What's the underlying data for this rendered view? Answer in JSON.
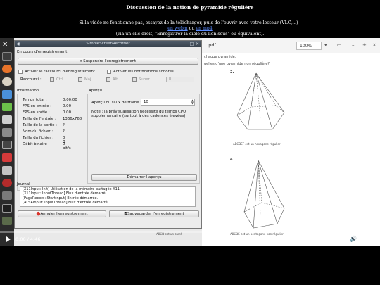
{
  "page": {
    "title": "Discussion de la notion de pyramide régulière",
    "info_line1": "Si la vidéo ne fonctionne pas, essayez de la télécharger, puis de l'ouvrir avec votre lecteur (VLC,...) :",
    "link_webm": "en webm",
    "link_sep": " ou ",
    "link_mp4": "en mp4",
    "info_line3": "(via un clic droit, \"Enregistrer la cible du lien sous\" ou équivalent)."
  },
  "pdf": {
    "filename": "...pdf",
    "zoom": "100%",
    "line1": "chaque pyramide.",
    "line2": "uelles d'une pyramide non régulière?",
    "fig2_num": "2.",
    "fig2_caption": "ABCDEF est un hexagone régulier",
    "fig4_num": "4.",
    "bottom_left": "ABCD est un carré",
    "bottom_right": "ABCDE est un pentagone non régulier"
  },
  "recorder": {
    "window_title": "SimpleScreenRecorder",
    "section_recording": "En cours d'enregistrement",
    "pause_button": "Suspendre l'enregistrement",
    "hotkey_label": "Activer le raccourci d'enregistrement",
    "sound_label": "Activer les notifications sonores",
    "shortcut_label": "Raccourci :",
    "mod_ctrl": "Ctrl",
    "mod_shift": "Maj",
    "mod_alt": "Alt",
    "mod_super": "Super",
    "key_value": "R",
    "info_title": "Information",
    "info_rows": [
      {
        "label": "Temps total :",
        "value": "0:00:00"
      },
      {
        "label": "FPS en entrée :",
        "value": "0.00"
      },
      {
        "label": "FPS en sortie :",
        "value": "0.00"
      },
      {
        "label": "Taille de l'entrée :",
        "value": "1366x768"
      },
      {
        "label": "Taille de la sortie :",
        "value": "?"
      },
      {
        "label": "Nom du fichier :",
        "value": "?"
      },
      {
        "label": "Taille du fichier :",
        "value": "0 B"
      },
      {
        "label": "Débit binaire :",
        "value": "0 bit/s"
      }
    ],
    "preview_title": "Aperçu",
    "preview_rate_label": "Aperçu du taux de trame :",
    "preview_rate_value": "10",
    "preview_note": "Note : la prévisualisation nécessite du temps CPU supplémentaire (surtout à des cadences élevées).",
    "start_preview_button": "Démarrer l'aperçu",
    "journal_title": "Journal",
    "journal_lines": [
      "[X11Input::Init] Utilisation de la mémoire partagée X11.",
      "[X11Input::InputThread] Flux d'entrée démarré.",
      "[PageRecord::StartInput] Entrée démarrée.",
      "[ALSAInput::InputThread] Flux d'entrée démarré."
    ],
    "cancel_button": "Annuler l'enregistrement",
    "save_button": "Sauvegarder l'enregistrement"
  },
  "player": {
    "time": "0:00 / 4:46"
  },
  "colors": {
    "link": "#5b8cff",
    "titlebar": "#434d58",
    "cancel_icon": "#d9342b"
  }
}
